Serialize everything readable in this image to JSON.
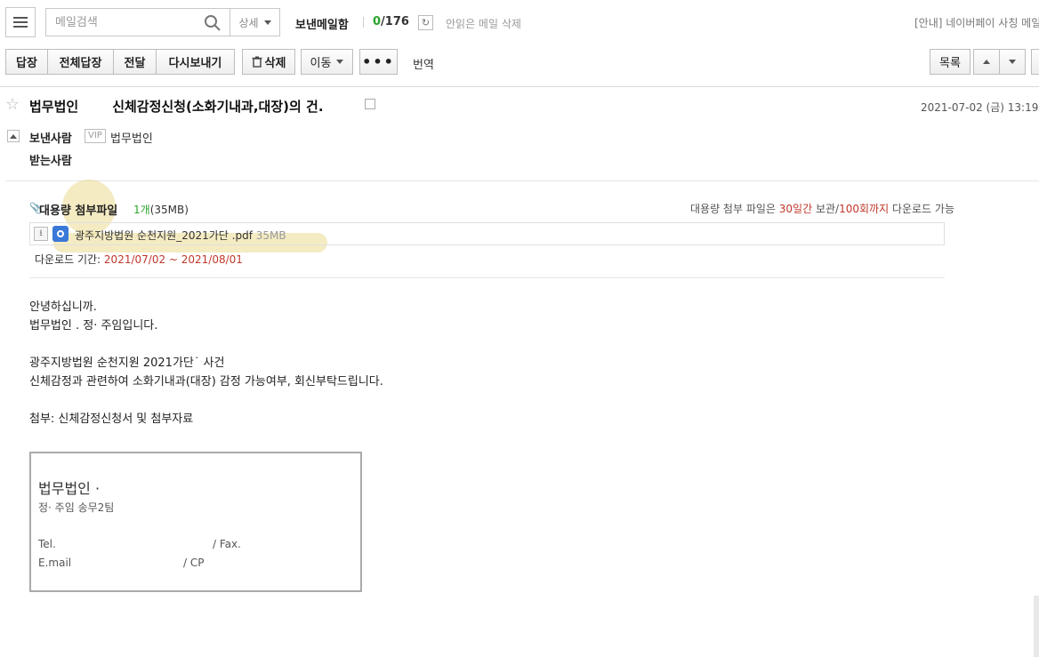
{
  "search": {
    "placeholder": "메일검색",
    "detail_label": "상세"
  },
  "mailbox": {
    "title": "보낸메일함",
    "unread": "0",
    "slash": "/",
    "total": "176",
    "delete_unread_label": "안읽은 메일 삭제"
  },
  "notice": "[안내] 네이버페이 사칭 메일 주",
  "toolbar": {
    "reply": "답장",
    "reply_all": "전체답장",
    "forward": "전달",
    "resend": "다시보내기",
    "delete": "삭제",
    "move": "이동",
    "more": "•••",
    "translate": "번역",
    "list": "목록"
  },
  "mail": {
    "subject_prefix": "법무법인",
    "subject": "신체감정신청(소화기내과,대장)의 건.",
    "date": "2021-07-02 (금) 13:19",
    "sender_label": "보낸사람",
    "vip_badge": "VIP",
    "sender_name": "법무법인",
    "receiver_label": "받는사람"
  },
  "attachment": {
    "title": "대용량 첨부파일",
    "count": "1개",
    "total_size": "(35MB)",
    "info_prefix": "대용량 첨부 파일은 ",
    "info_days": "30일간",
    "info_mid": " 보관/",
    "info_times": "100회까지",
    "info_suffix": " 다운로드 가능",
    "file_name": "광주지방법원 순천지원_2021가단        .pdf",
    "file_size": "35MB",
    "period_label": "다운로드 기간: ",
    "period": "2021/07/02 ~ 2021/08/01"
  },
  "body": {
    "greeting": "안녕하십니까.",
    "intro": "법무법인                             . 정·        주임입니다.",
    "case": "광주지방법원 순천지원 2021가단˙          사건",
    "request": "신체감정과 관련하여 소화기내과(대장) 감정 가능여부, 회신부탁드립니다.",
    "attachment_note": "첨부: 신체감정신청서 및 첨부자료"
  },
  "signature": {
    "firm": "법무법인  ·",
    "title": "정·        주임 송무2팀",
    "tel": "Tel.",
    "fax": "/ Fax.",
    "email": "E.mail",
    "cp": "/ CP"
  }
}
